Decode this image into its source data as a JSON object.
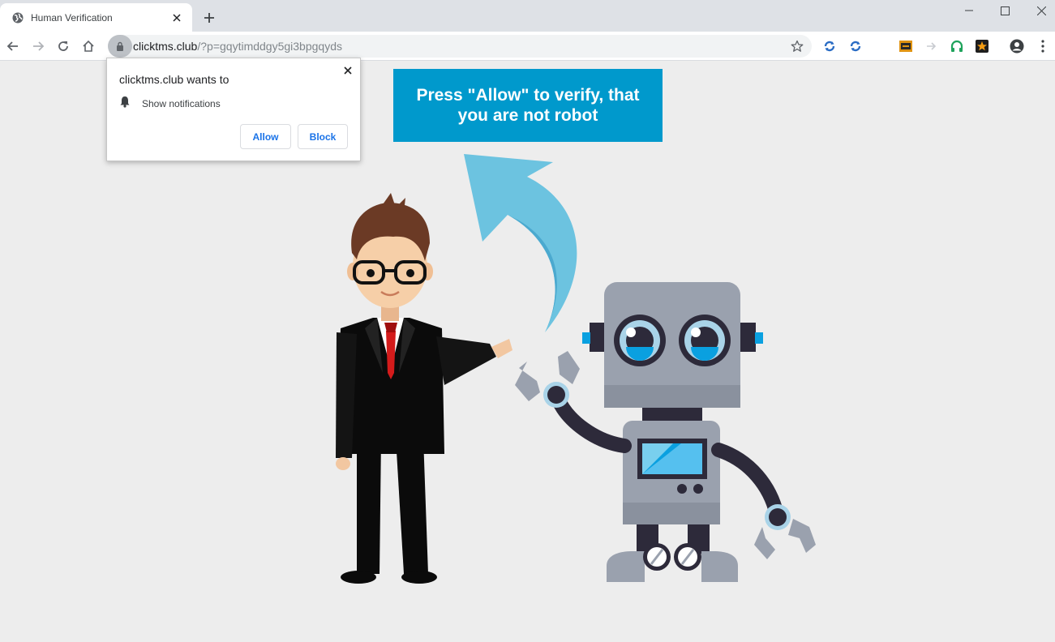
{
  "tab": {
    "title": "Human Verification",
    "favicon": "globe-icon"
  },
  "toolbar": {
    "url_host": "clicktms.club",
    "url_path": "/?p=gqytimddgy5gi3bpgqyds"
  },
  "popup": {
    "title": "clicktms.club wants to",
    "permission": "Show notifications",
    "allow_label": "Allow",
    "block_label": "Block"
  },
  "page": {
    "banner_line1": "Press \"Allow\" to verify, that",
    "banner_line2": "you are not robot"
  },
  "colors": {
    "banner": "#0099cc",
    "arrow": "#5bbbd9",
    "robot_body": "#9aa1ae",
    "robot_dark": "#2d2a3a",
    "screen": "#0aa0e0"
  }
}
